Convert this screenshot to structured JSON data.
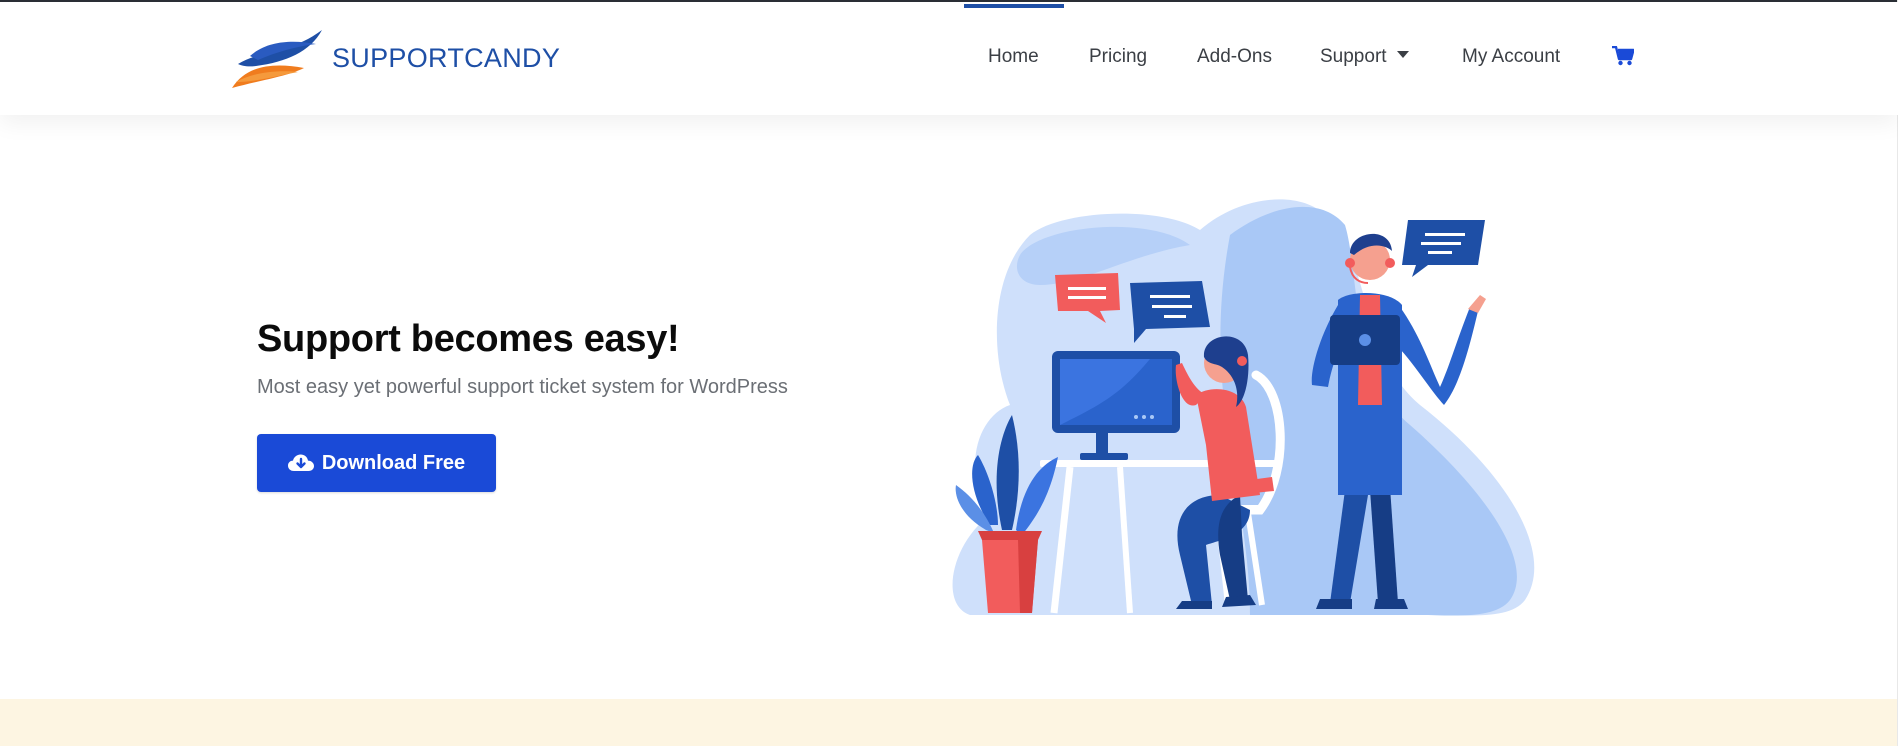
{
  "brand": {
    "name": "SUPPORTCANDY",
    "colors": {
      "primary": "#1e4fa6",
      "accent": "#f07c1e",
      "button": "#1a4ad7"
    }
  },
  "nav": {
    "items": [
      {
        "label": "Home",
        "active": true
      },
      {
        "label": "Pricing"
      },
      {
        "label": "Add-Ons"
      },
      {
        "label": "Support",
        "has_dropdown": true
      },
      {
        "label": "My Account"
      }
    ],
    "cart_icon": "shopping-cart-icon"
  },
  "hero": {
    "title": "Support becomes easy!",
    "subtitle": "Most easy yet powerful support ticket system for WordPress",
    "button": {
      "label": "Download Free",
      "icon": "cloud-download-icon"
    },
    "illustration": "support-agents-illustration"
  }
}
